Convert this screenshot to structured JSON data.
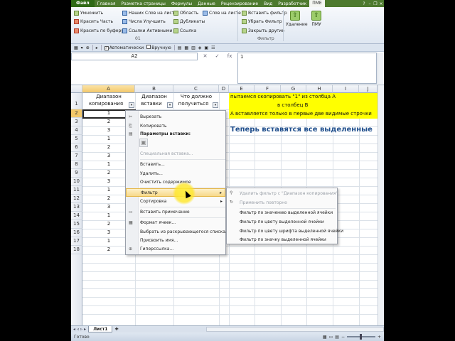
{
  "ribbon": {
    "tabs": [
      "Файл",
      "Главная",
      "Разметка страницы",
      "Формулы",
      "Данные",
      "Рецензирование",
      "Вид",
      "Разработчик",
      "ПМЕ"
    ],
    "active_tab": "ПМЕ",
    "col1": [
      "Умножить",
      "Красить Часть",
      "Красить по буферу"
    ],
    "col2": [
      "Наших Слов на листе",
      "Числа Улучшить",
      "Ссылки Активными"
    ],
    "col3": [
      "Область",
      "Дубликаты",
      "Ссылка"
    ],
    "col4": [
      "Слов на листе"
    ],
    "col5": [
      "Вставить фильтр",
      "Убрать Фильтр",
      "Закрыть другие"
    ],
    "big_buttons": [
      "Удаление",
      "ПМУ"
    ],
    "group_labels": [
      "01",
      "Фильтр"
    ]
  },
  "qat": {
    "auto_label": "Автоматически",
    "manual_label": "Вручную"
  },
  "formula_bar": {
    "name_box": "A2",
    "content": "1"
  },
  "grid": {
    "columns": [
      "A",
      "B",
      "C",
      "D",
      "E",
      "F",
      "G",
      "H",
      "I",
      "J"
    ],
    "rows": [
      "1",
      "2",
      "3",
      "4",
      "5",
      "6",
      "7",
      "8",
      "9",
      "10",
      "11",
      "12",
      "13",
      "14",
      "15",
      "16",
      "17",
      "18"
    ],
    "headers": {
      "a1_line1": "Диапазон",
      "a1_line2": "копирования",
      "b1_line1": "Диапазон",
      "b1_line2": "вставки",
      "c1_line1": "Что должно",
      "c1_line2": "получиться"
    },
    "col_a_values": [
      "1",
      "2",
      "3",
      "1",
      "2",
      "3",
      "1",
      "2",
      "3",
      "1",
      "2",
      "3",
      "1",
      "2",
      "3",
      "1",
      "2"
    ],
    "yellow_text": [
      "пытаемся скопировать \"1\" из столбца А",
      "в столбец В",
      "А вставляется только в первые две видимые строчки"
    ],
    "blue_text": "Теперь вставятся все выделенные"
  },
  "context_menu": {
    "cut": "Вырезать",
    "copy": "Копировать",
    "paste_options": "Параметры вставки:",
    "paste_special": "Специальная вставка...",
    "insert": "Вставить...",
    "delete": "Удалить...",
    "clear": "Очистить содержимое",
    "filter": "Фильтр",
    "sort": "Сортировка",
    "insert_comment": "Вставить примечание",
    "format_cells": "Формат ячеек...",
    "pick_list": "Выбрать из раскрывающегося списка...",
    "name_range": "Присвоить имя...",
    "hyperlink": "Гиперссылка..."
  },
  "filter_submenu": {
    "clear_filter": "Удалить фильтр с \"Диапазон копирования\"",
    "reapply": "Применить повторно",
    "by_value": "Фильтр по значению выделенной ячейки",
    "by_color": "Фильтр по цвету выделенной ячейки",
    "by_font_color": "Фильтр по цвету шрифта выделенной ячейки",
    "by_icon": "Фильтр по значку выделенной ячейки"
  },
  "sheet": {
    "tab": "Лист1",
    "status": "Готово"
  },
  "colors": {
    "ribbon_green": "#4d7a2e",
    "yellow_fill": "#ffff00",
    "blue_text": "#1f4e8c",
    "highlight": "#f7d98a"
  }
}
